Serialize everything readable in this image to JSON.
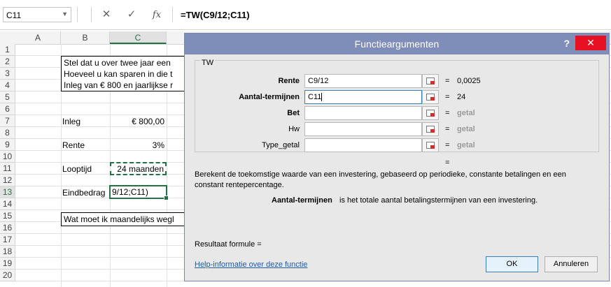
{
  "formula_bar": {
    "name_box": "C11",
    "icons": [
      "dropdown-icon",
      "cancel-icon",
      "enter-icon",
      "fx-icon"
    ],
    "fx_label": "fx",
    "formula": "=TW(C9/12;C11)"
  },
  "columns": [
    "A",
    "B",
    "C"
  ],
  "rows": [
    "1",
    "2",
    "3",
    "4",
    "5",
    "6",
    "7",
    "8",
    "9",
    "10",
    "11",
    "12",
    "13",
    "14",
    "15",
    "16",
    "17",
    "18",
    "19",
    "20"
  ],
  "sheet": {
    "intro_line1": "Stel dat u over twee jaar een",
    "intro_line2": "Hoeveel u kan sparen in die t",
    "intro_line3": "Inleg van € 800 en jaarlijkse r",
    "inleg_label": "Inleg",
    "inleg_value": "€ 800,00",
    "rente_label": "Rente",
    "rente_value": "3%",
    "looptijd_label": "Looptijd",
    "looptijd_value": "24 maanden",
    "eindbedrag_label": "Eindbedrag",
    "eindbedrag_value": "9/12;C11)",
    "question": "Wat moet ik maandelijks wegl"
  },
  "dialog": {
    "title": "Functieargumenten",
    "help_glyph": "?",
    "close_glyph": "✕",
    "function_name": "TW",
    "args": [
      {
        "label": "Rente",
        "value": "C9/12",
        "eq": "=",
        "result": "0,0025",
        "bold": true
      },
      {
        "label": "Aantal-termijnen",
        "value": "C11",
        "eq": "=",
        "result": "24",
        "bold": true
      },
      {
        "label": "Bet",
        "value": "",
        "eq": "=",
        "result": "getal",
        "bold": true
      },
      {
        "label": "Hw",
        "value": "",
        "eq": "=",
        "result": "getal",
        "bold": false
      },
      {
        "label": "Type_getal",
        "value": "",
        "eq": "=",
        "result": "getal",
        "bold": false
      }
    ],
    "result_eq": "=",
    "description_line1": "Berekent de toekomstige waarde van een investering, gebaseerd op periodieke, constante betalingen en een",
    "description_line2": "constant rentepercentage.",
    "arg_help_name": "Aantal-termijnen",
    "arg_help_text": "is het totale aantal betalingstermijnen van een investering.",
    "result_formula": "Resultaat formule =",
    "help_link": "Help-informatie over deze functie",
    "ok": "OK",
    "cancel": "Annuleren"
  }
}
